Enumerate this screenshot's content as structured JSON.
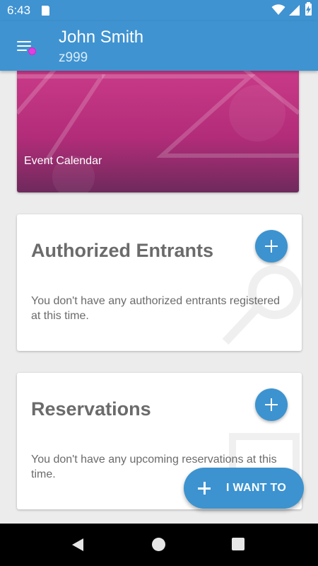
{
  "status_bar": {
    "time": "6:43",
    "icons": [
      "sd-card-icon",
      "wifi-icon",
      "signal-icon",
      "battery-charging-icon"
    ]
  },
  "app_bar": {
    "title": "John Smith",
    "subtitle": "z999",
    "menu_icon": "hamburger-menu-icon",
    "notification_dot_color": "#e040e0",
    "background_color": "#3f93d1"
  },
  "banner": {
    "label": "Event Calendar",
    "color": "#c93a87"
  },
  "cards": [
    {
      "title": "Authorized Entrants",
      "body": "You don't have any authorized entrants registered at this time.",
      "action_icon": "plus-icon"
    },
    {
      "title": "Reservations",
      "body": "You don't have any upcoming reservations at this time.",
      "action_icon": "plus-icon"
    }
  ],
  "fab": {
    "label": "I WANT TO",
    "icon": "plus-icon",
    "color": "#3c93d0"
  },
  "nav_bar": {
    "icons": [
      "back-icon",
      "home-icon",
      "recents-icon"
    ]
  }
}
